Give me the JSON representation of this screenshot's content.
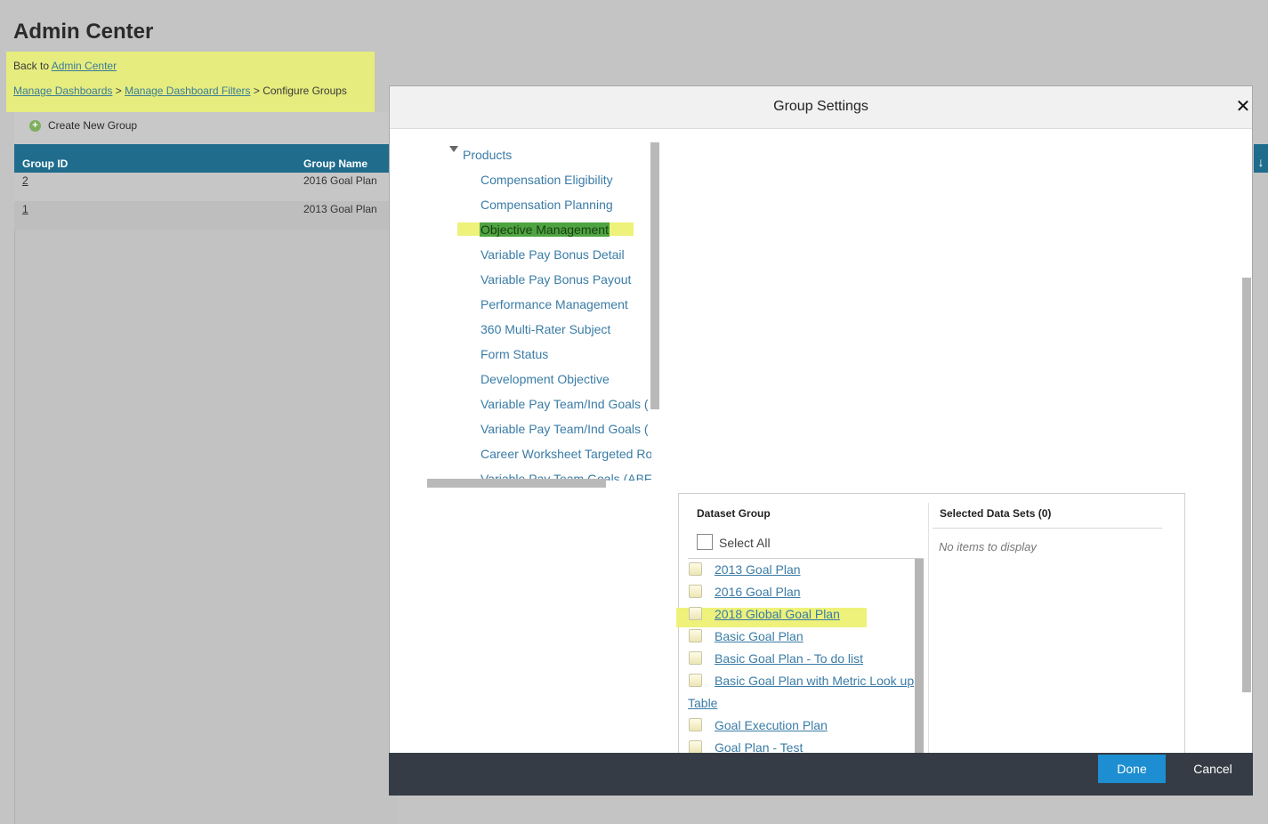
{
  "page": {
    "title": "Admin Center",
    "back_prefix": "Back to",
    "back_link": "Admin Center",
    "breadcrumb": {
      "link1": "Manage Dashboards",
      "sep1": ">",
      "link2": "Manage Dashboard Filters",
      "sep2": ">",
      "current": "Configure Groups"
    },
    "create_group_label": "Create New Group",
    "table": {
      "headers": [
        "Group ID",
        "Group Name"
      ],
      "rows": [
        {
          "id": "2",
          "name": "2016 Goal Plan"
        },
        {
          "id": "1",
          "name": "2013 Goal Plan"
        }
      ]
    }
  },
  "modal": {
    "title": "Group Settings",
    "close_symbol": "✕",
    "tree": {
      "root": "Products",
      "items": [
        "Compensation Eligibility",
        "Compensation Planning",
        "Objective Management",
        "Variable Pay Bonus Detail",
        "Variable Pay Bonus Payout",
        "Performance Management",
        "360 Multi-Rater Subject",
        "Form Status",
        "Development Objective",
        "Variable Pay Team/Ind Goals (",
        "Variable Pay Team/Ind Goals (",
        "Career Worksheet Targeted Ro",
        "Variable Pay Team Goals (ABF"
      ],
      "selected": "Objective Management"
    },
    "dataset": {
      "group_header": "Dataset Group",
      "select_all": "Select All",
      "items": [
        "2013 Goal Plan",
        "2016 Goal Plan",
        "2018 Global Goal Plan",
        "Basic Goal Plan",
        "Basic Goal Plan - To do list",
        "Basic Goal Plan with Metric Look up",
        "Table",
        "Goal Execution Plan",
        "Goal Plan - Test"
      ],
      "selected_header": "Selected Data Sets (0)",
      "empty_message": "No items to display"
    },
    "footer": {
      "done": "Done",
      "cancel": "Cancel"
    }
  },
  "colors": {
    "accent": "#1c8ed1",
    "table_header": "#1f6c8c",
    "highlight": "#eef27a",
    "selection": "#4ea441",
    "footer": "#353c45"
  }
}
